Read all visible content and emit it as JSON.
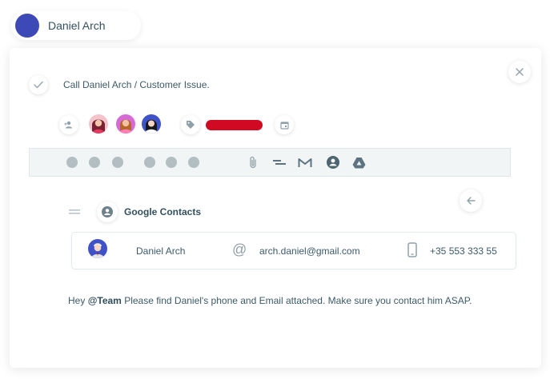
{
  "user": {
    "name": "Daniel Arch",
    "avatar_color": "#3d49b6"
  },
  "task": {
    "title": "Call Daniel Arch / Customer Issue."
  },
  "meta": {
    "assignees": [
      "female-avatar-1",
      "female-avatar-2",
      "female-avatar-3"
    ],
    "tag_color": "#cf0a22"
  },
  "toolbar": {
    "icons": [
      "attachment-icon",
      "align-icon",
      "gmail-icon",
      "contacts-icon",
      "drive-icon"
    ]
  },
  "contacts": {
    "title": "Google Contacts",
    "contact": {
      "name": "Daniel Arch",
      "email": "arch.daniel@gmail.com",
      "phone": "+35 553 333 55"
    }
  },
  "message": {
    "prefix": "Hey ",
    "mention": "@Team",
    "text": " Please find Daniel's phone and Email attached. Make sure you contact him ASAP."
  }
}
